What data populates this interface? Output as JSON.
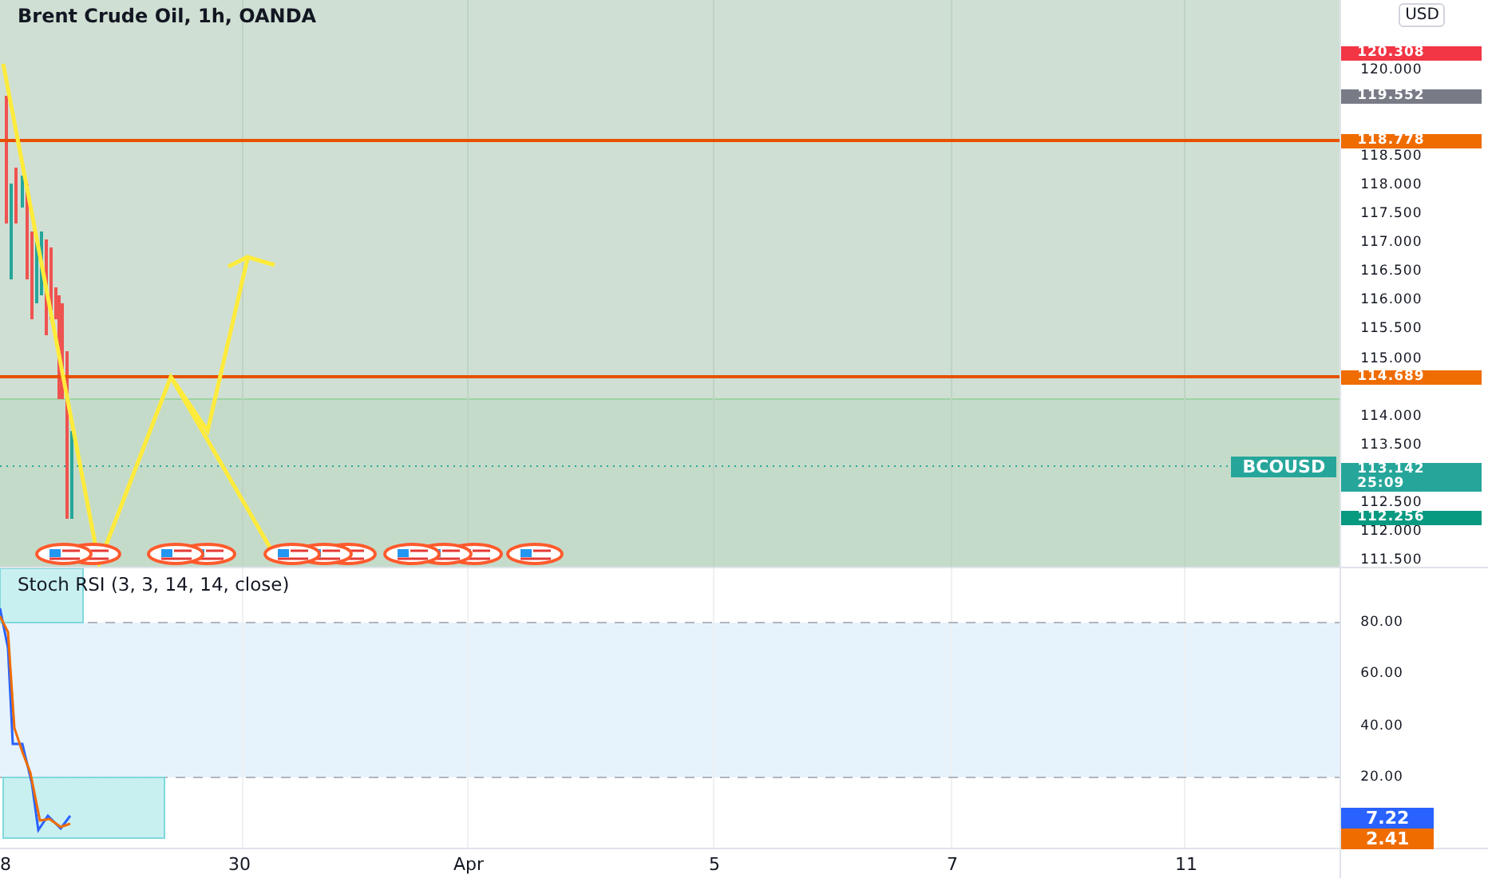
{
  "chart": {
    "title": "Brent Crude Oil, 1h, OANDA",
    "currency": "USD",
    "price_ticks": [
      "120.000",
      "118.500",
      "118.000",
      "117.500",
      "117.000",
      "116.500",
      "116.000",
      "115.500",
      "115.000",
      "114.000",
      "113.500",
      "112.500",
      "112.000",
      "111.500"
    ],
    "price_badges": [
      {
        "text": "120.308",
        "color": "#f23645"
      },
      {
        "text": "119.552",
        "color": "#787b86"
      },
      {
        "text": "118.778",
        "color": "#ef6c00"
      },
      {
        "text": "114.689",
        "color": "#ef6c00"
      },
      {
        "text": "113.142",
        "sub": "25:09",
        "color": "#26a69a"
      },
      {
        "text": "112.256",
        "color": "#089981"
      }
    ],
    "symbol_label": "BCOUSD"
  },
  "indicator": {
    "title": "Stoch RSI (3, 3, 14, 14, close)",
    "ticks": [
      "80.00",
      "60.00",
      "40.00",
      "20.00"
    ],
    "badges": [
      {
        "text": "7.22",
        "color": "#2962ff"
      },
      {
        "text": "2.41",
        "color": "#ef6c00"
      }
    ]
  },
  "time_axis": [
    "8",
    "30",
    "Apr",
    "5",
    "7",
    "11"
  ]
}
